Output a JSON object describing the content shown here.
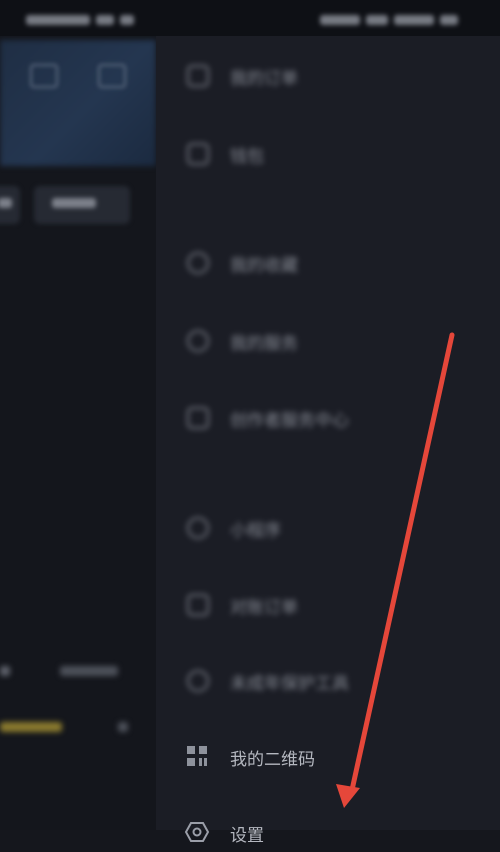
{
  "drawer": {
    "items": [
      {
        "label": "我的订单",
        "icon": "order-icon",
        "blurred": true
      },
      {
        "label": "钱包",
        "icon": "wallet-icon",
        "blurred": true
      },
      {
        "label": "我的收藏",
        "icon": "star-icon",
        "blurred": true
      },
      {
        "label": "我的服务",
        "icon": "service-icon",
        "blurred": true
      },
      {
        "label": "创作者服务中心",
        "icon": "creator-icon",
        "blurred": true
      },
      {
        "label": "小程序",
        "icon": "mini-program-icon",
        "blurred": true
      },
      {
        "label": "对账订单",
        "icon": "bill-icon",
        "blurred": true
      },
      {
        "label": "未成年保护工具",
        "icon": "shield-icon",
        "blurred": true
      },
      {
        "label": "我的二维码",
        "icon": "qr-code-icon",
        "blurred": false
      },
      {
        "label": "设置",
        "icon": "settings-icon",
        "blurred": false
      }
    ]
  },
  "annotation": {
    "color": "#e5473a",
    "type": "arrow pointing to settings"
  }
}
